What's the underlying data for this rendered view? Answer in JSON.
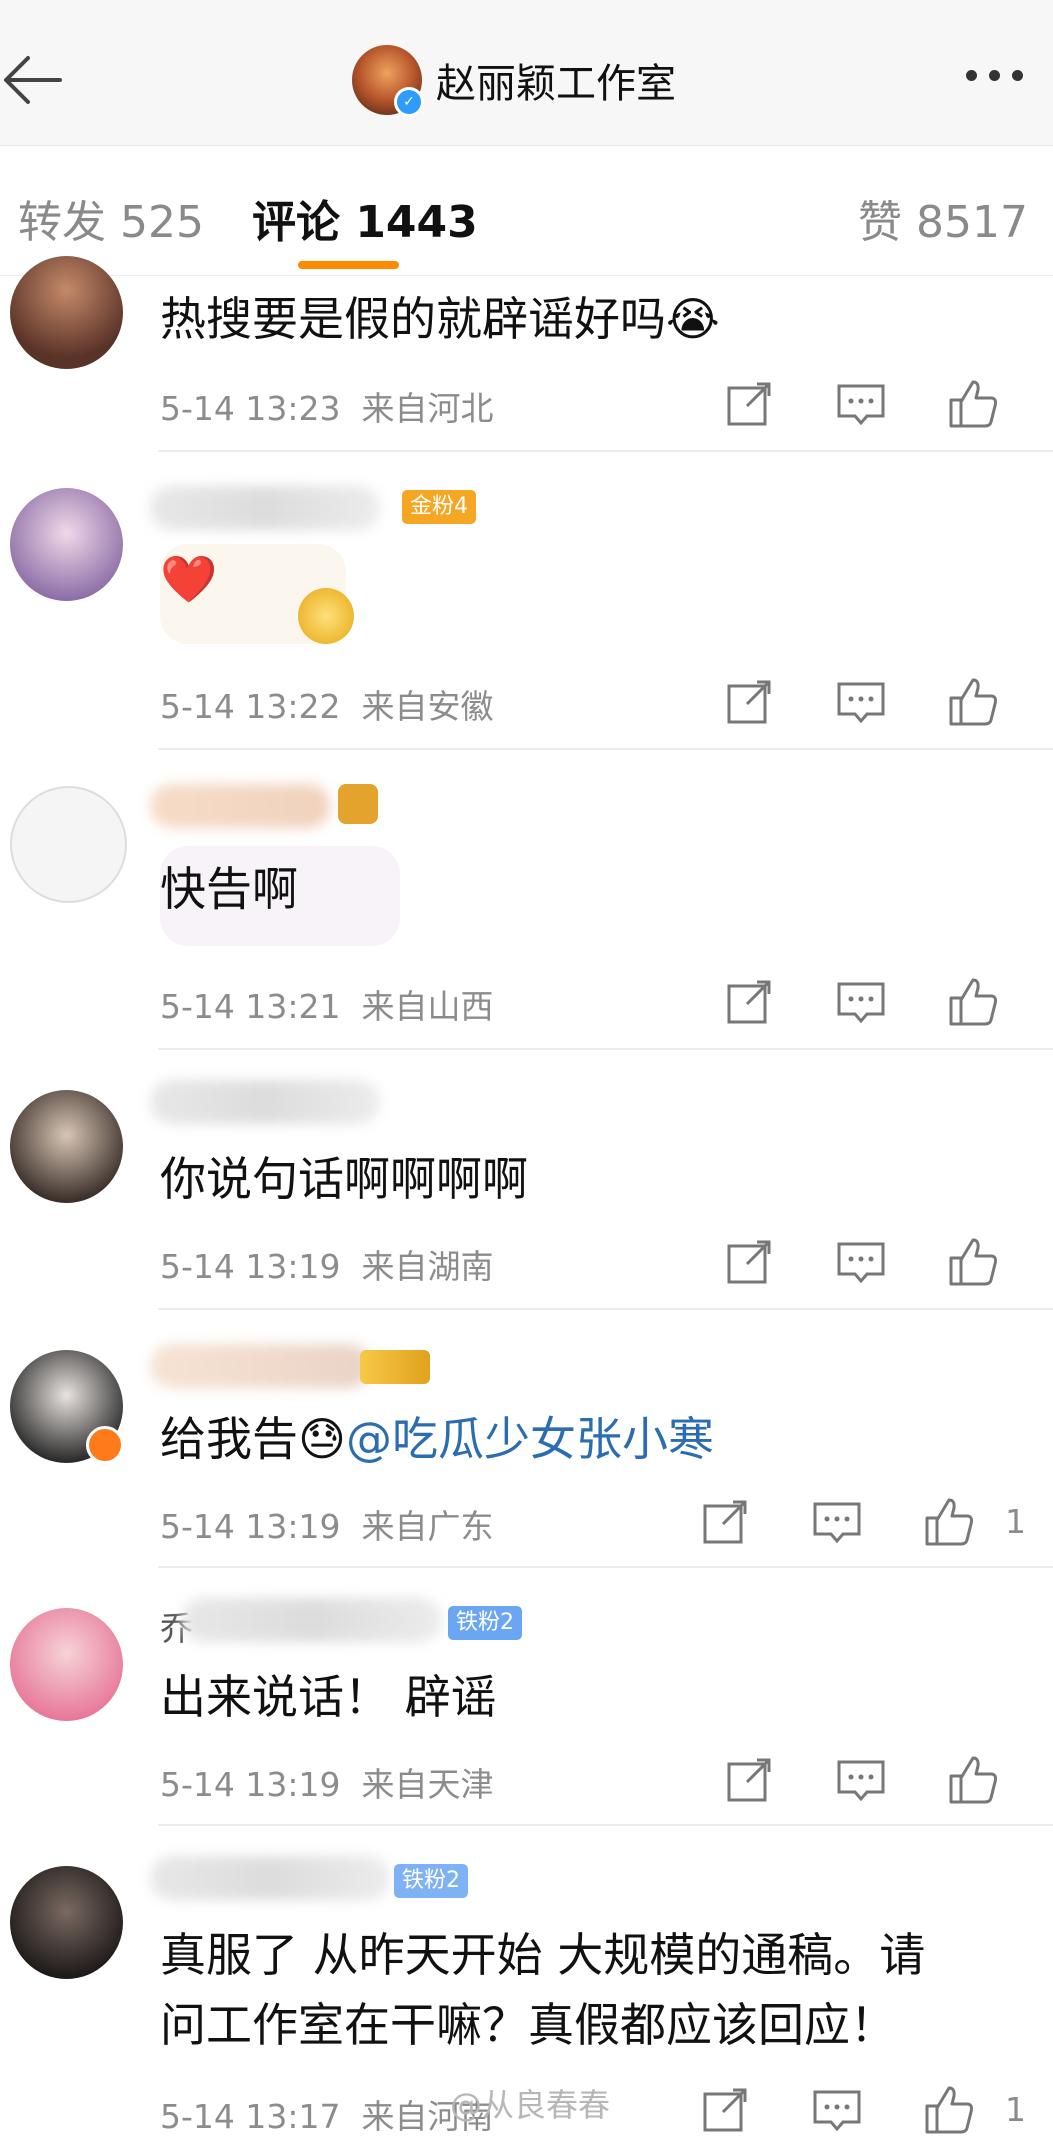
{
  "header": {
    "title": "赵丽颖工作室"
  },
  "tabs": [
    {
      "label": "转发 525"
    },
    {
      "label": "评论 1443"
    },
    {
      "label": "赞 8517"
    }
  ],
  "comments": [
    {
      "text": "热搜要是假的就辟谣好吗😭",
      "time": "5-14 13:23",
      "location": "来自河北",
      "likes": ""
    },
    {
      "badge": "金粉4",
      "text": "❤️",
      "time": "5-14 13:22",
      "location": "来自安徽",
      "likes": ""
    },
    {
      "text": "快告啊",
      "time": "5-14 13:21",
      "location": "来自山西",
      "likes": ""
    },
    {
      "text": "你说句话啊啊啊啊",
      "time": "5-14 13:19",
      "location": "来自湖南",
      "likes": ""
    },
    {
      "text_prefix": "给我告😓",
      "mention": "@吃瓜少女张小寒",
      "time": "5-14 13:19",
      "location": "来自广东",
      "likes": "1"
    },
    {
      "name_prefix": "乔",
      "badge": "铁粉2",
      "text": "出来说话！ 辟谣",
      "time": "5-14 13:19",
      "location": "来自天津",
      "likes": ""
    },
    {
      "badge": "铁粉2",
      "text_line1": "真服了 从昨天开始 大规模的通稿。请",
      "text_line2": "问工作室在干嘛？真假都应该回应！",
      "time": "5-14 13:17",
      "location": "来自河南",
      "likes": "1"
    }
  ],
  "watermark": "@从良春春",
  "colors": {
    "accent": "#ff8a00",
    "link": "#2b6db0",
    "meta": "#8c8c8c"
  }
}
